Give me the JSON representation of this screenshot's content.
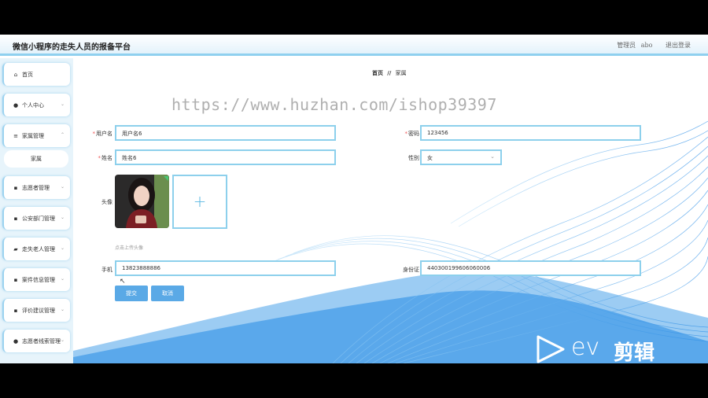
{
  "header": {
    "app_title": "微信小程序的走失人员的报备平台",
    "role_label": "管理员",
    "username": "abo",
    "logout_label": "退出登录"
  },
  "sidebar": {
    "items": [
      {
        "label": "首页",
        "icon": "home-icon"
      },
      {
        "label": "个人中心",
        "icon": "user-icon"
      },
      {
        "label": "家属管理",
        "icon": "sliders-icon"
      },
      {
        "label": "志愿者管理",
        "icon": "grid-icon"
      },
      {
        "label": "公安部门管理",
        "icon": "grid-icon"
      },
      {
        "label": "走失老人管理",
        "icon": "folder-icon"
      },
      {
        "label": "案件信息管理",
        "icon": "grid-icon"
      },
      {
        "label": "评价建议管理",
        "icon": "grid-icon"
      },
      {
        "label": "志愿者线索管理",
        "icon": "bulb-icon"
      }
    ],
    "sub_item": "家属"
  },
  "breadcrumb": {
    "home": "首页",
    "sep": "//",
    "current": "家属"
  },
  "form": {
    "username_label": "用户名",
    "username_value": "用户名6",
    "password_label": "密码",
    "password_value": "123456",
    "name_label": "姓名",
    "name_value": "姓名6",
    "gender_label": "性别",
    "gender_value": "女",
    "avatar_label": "头像",
    "upload_tip": "点击上传头像",
    "phone_label": "手机",
    "phone_value": "13823888886",
    "idcard_label": "身份证",
    "idcard_value": "440300199606060006",
    "submit_label": "提交",
    "cancel_label": "取消"
  },
  "overlay": {
    "watermark": "https://www.huzhan.com/ishop39397",
    "logo_text": "ev",
    "logo_text2": "剪辑"
  },
  "colors": {
    "accent": "#5aa9e6",
    "border": "#8dd0ec",
    "sidebar_bg": "#e7f4fb"
  }
}
